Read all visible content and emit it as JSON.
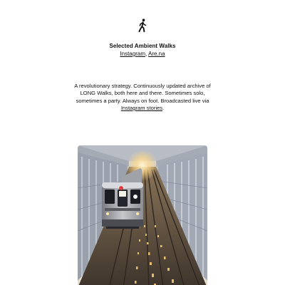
{
  "header": {
    "logo_icon": "walking-person-icon",
    "title": "Selected Ambient Walks",
    "links": [
      {
        "label": "Instagram"
      },
      {
        "label": "Are.na"
      }
    ],
    "link_separator": ", "
  },
  "intro": {
    "text_before_link": "A revolutionary strategy. Continuously updated archive of LONG Walks, both here and there. Sometimes solo, sometimes a party. Always on foot. Broadcasted live via ",
    "link_label": "Instagram stories",
    "text_after_link": "."
  },
  "featured_walk": {
    "image": "subway-train-arriving-on-elevated-tracks"
  }
}
